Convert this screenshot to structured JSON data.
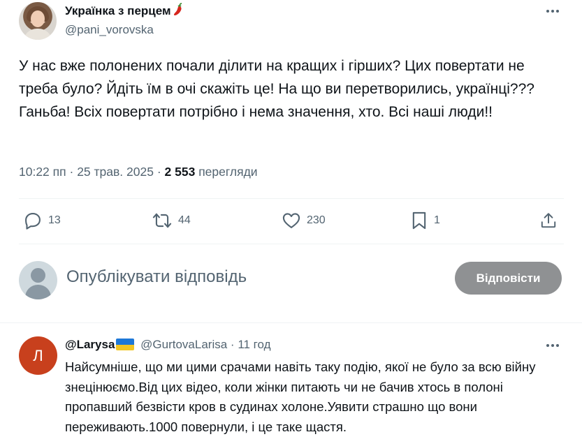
{
  "tweet": {
    "author": {
      "display_name": "Українка з перцем",
      "handle": "@pani_vorovska",
      "name_emoji": "chili-pepper"
    },
    "text": "У нас вже полонених почали ділити на кращих і гірших? Цих повертати не треба було? Йдіть їм в очі скажіть це! На що ви перетворились, українці??? Ганьба! Всіх повертати потрібно і нема значення, хто. Всі наші люди!!",
    "time": "10:22 пп",
    "date": "25 трав. 2025",
    "views_count": "2 553",
    "views_label": "перегляди",
    "separator": "·"
  },
  "actions": {
    "replies": "13",
    "reposts": "44",
    "likes": "230",
    "bookmarks": "1"
  },
  "composer": {
    "placeholder": "Опублікувати відповідь",
    "button_label": "Відповісти"
  },
  "reply": {
    "avatar_letter": "Л",
    "avatar_color": "#c8401d",
    "display_name": "@Larysa",
    "flag": "ukraine-flag",
    "handle": "@GurtovaLarisa",
    "separator": "·",
    "time": "11 год",
    "text": "Найсумніше, що ми цими срачами навіть таку подію, якої не було за всю війну знецінюємо.Від цих відео, коли жінки питають чи не бачив хтось в полоні пропавший безвісти кров в судинах холоне.Уявити страшно що вони переживають.1000 повернули, і це таке щастя."
  },
  "colors": {
    "text_primary": "#0f1419",
    "text_secondary": "#536471",
    "divider": "#eff3f4",
    "button_disabled": "#8f9193"
  }
}
